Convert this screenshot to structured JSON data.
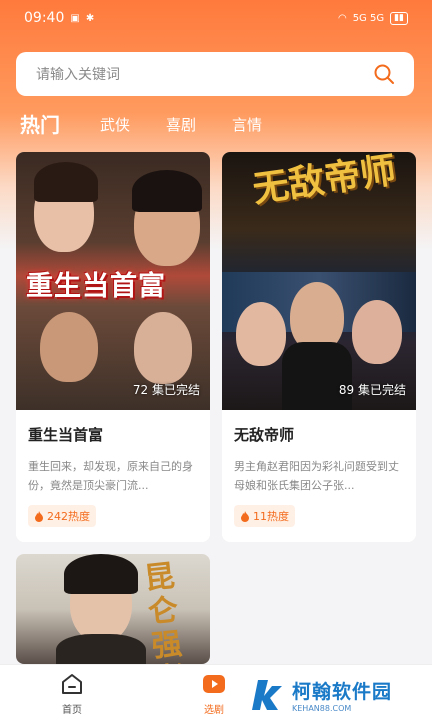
{
  "status_bar": {
    "time": "09:40",
    "right_text": "5G 5G"
  },
  "search": {
    "placeholder": "请输入关键词"
  },
  "tabs": [
    {
      "label": "热门",
      "active": true
    },
    {
      "label": "武侠",
      "active": false
    },
    {
      "label": "喜剧",
      "active": false
    },
    {
      "label": "言情",
      "active": false
    }
  ],
  "cards": [
    {
      "poster_title": "重生当首富",
      "episodes": "72 集已完结",
      "title": "重生当首富",
      "desc": "重生回来，却发现，原来自己的身份，竟然是顶尖豪门流...",
      "heat": "242热度"
    },
    {
      "poster_title": "无敌帝师",
      "episodes": "89 集已完结",
      "title": "无敌帝师",
      "desc": "男主角赵君阳因为彩礼问题受到丈母娘和张氏集团公子张...",
      "heat": "11热度"
    },
    {
      "poster_title": "昆仑强者"
    }
  ],
  "bottom_nav": {
    "home_label": "首页",
    "select_label": "选剧"
  },
  "watermark": {
    "text": "柯翰软件园",
    "domain": "KEHAN88.COM"
  },
  "colors": {
    "accent": "#f36b1c",
    "header_gradient_top": "#ff7a3c"
  }
}
